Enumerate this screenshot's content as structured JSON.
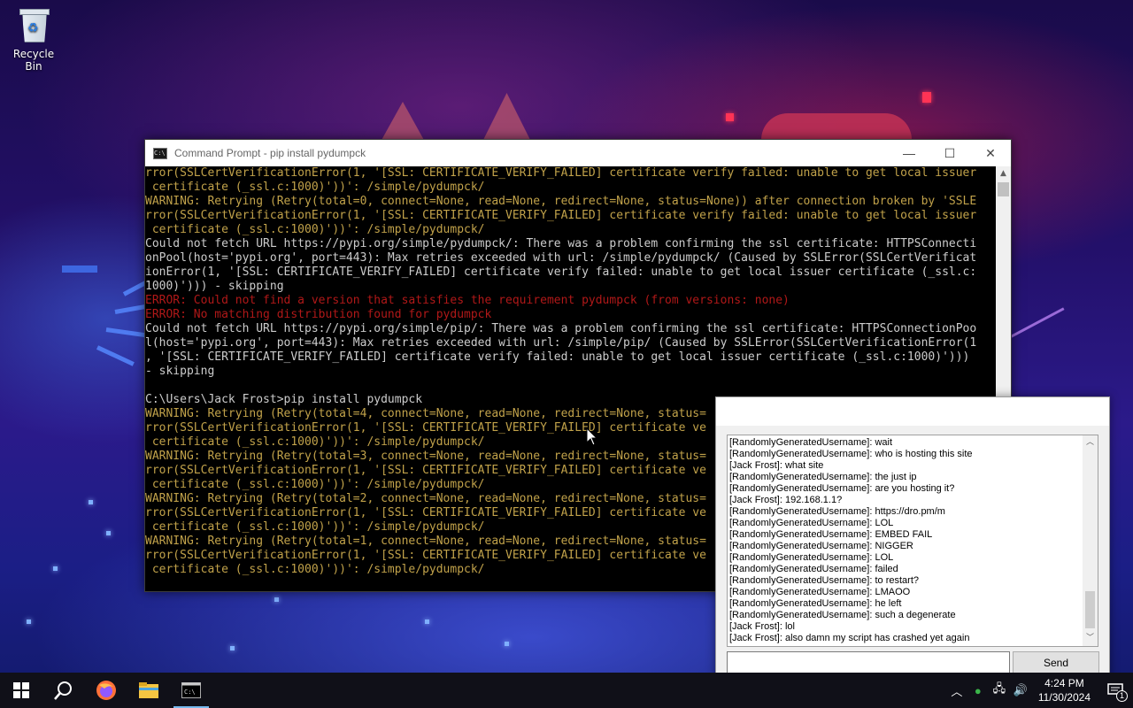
{
  "desktop": {
    "recycle_bin_label": "Recycle Bin"
  },
  "cmd_window": {
    "title": "Command Prompt - pip  install pydumpck",
    "minimize": "—",
    "maximize": "☐",
    "close": "✕",
    "lines": [
      {
        "text": "rror(SSLCertVerificationError(1, '[SSL: CERTIFICATE_VERIFY_FAILED] certificate verify failed: unable to get local issuer",
        "color": "yellow"
      },
      {
        "text": " certificate (_ssl.c:1000)'))': /simple/pydumpck/",
        "color": "yellow"
      },
      {
        "text": "WARNING: Retrying (Retry(total=0, connect=None, read=None, redirect=None, status=None)) after connection broken by 'SSLE",
        "color": "yellow"
      },
      {
        "text": "rror(SSLCertVerificationError(1, '[SSL: CERTIFICATE_VERIFY_FAILED] certificate verify failed: unable to get local issuer",
        "color": "yellow"
      },
      {
        "text": " certificate (_ssl.c:1000)'))': /simple/pydumpck/",
        "color": "yellow"
      },
      {
        "text": "Could not fetch URL https://pypi.org/simple/pydumpck/: There was a problem confirming the ssl certificate: HTTPSConnecti",
        "color": "white"
      },
      {
        "text": "onPool(host='pypi.org', port=443): Max retries exceeded with url: /simple/pydumpck/ (Caused by SSLError(SSLCertVerificat",
        "color": "white"
      },
      {
        "text": "ionError(1, '[SSL: CERTIFICATE_VERIFY_FAILED] certificate verify failed: unable to get local issuer certificate (_ssl.c:",
        "color": "white"
      },
      {
        "text": "1000)'))) - skipping",
        "color": "white"
      },
      {
        "text": "ERROR: Could not find a version that satisfies the requirement pydumpck (from versions: none)",
        "color": "red"
      },
      {
        "text": "ERROR: No matching distribution found for pydumpck",
        "color": "red"
      },
      {
        "text": "Could not fetch URL https://pypi.org/simple/pip/: There was a problem confirming the ssl certificate: HTTPSConnectionPoo",
        "color": "white"
      },
      {
        "text": "l(host='pypi.org', port=443): Max retries exceeded with url: /simple/pip/ (Caused by SSLError(SSLCertVerificationError(1",
        "color": "white"
      },
      {
        "text": ", '[SSL: CERTIFICATE_VERIFY_FAILED] certificate verify failed: unable to get local issuer certificate (_ssl.c:1000)')))",
        "color": "white"
      },
      {
        "text": "- skipping",
        "color": "white"
      },
      {
        "text": "",
        "color": "white"
      },
      {
        "text": "C:\\Users\\Jack Frost>pip install pydumpck",
        "color": "white"
      },
      {
        "text": "WARNING: Retrying (Retry(total=4, connect=None, read=None, redirect=None, status=",
        "color": "yellow"
      },
      {
        "text": "rror(SSLCertVerificationError(1, '[SSL: CERTIFICATE_VERIFY_FAILED] certificate ve",
        "color": "yellow"
      },
      {
        "text": " certificate (_ssl.c:1000)'))': /simple/pydumpck/",
        "color": "yellow"
      },
      {
        "text": "WARNING: Retrying (Retry(total=3, connect=None, read=None, redirect=None, status=",
        "color": "yellow"
      },
      {
        "text": "rror(SSLCertVerificationError(1, '[SSL: CERTIFICATE_VERIFY_FAILED] certificate ve",
        "color": "yellow"
      },
      {
        "text": " certificate (_ssl.c:1000)'))': /simple/pydumpck/",
        "color": "yellow"
      },
      {
        "text": "WARNING: Retrying (Retry(total=2, connect=None, read=None, redirect=None, status=",
        "color": "yellow"
      },
      {
        "text": "rror(SSLCertVerificationError(1, '[SSL: CERTIFICATE_VERIFY_FAILED] certificate ve",
        "color": "yellow"
      },
      {
        "text": " certificate (_ssl.c:1000)'))': /simple/pydumpck/",
        "color": "yellow"
      },
      {
        "text": "WARNING: Retrying (Retry(total=1, connect=None, read=None, redirect=None, status=",
        "color": "yellow"
      },
      {
        "text": "rror(SSLCertVerificationError(1, '[SSL: CERTIFICATE_VERIFY_FAILED] certificate ve",
        "color": "yellow"
      },
      {
        "text": " certificate (_ssl.c:1000)'))': /simple/pydumpck/",
        "color": "yellow"
      }
    ]
  },
  "chat_window": {
    "messages": [
      "[RandomlyGeneratedUsername]: wait",
      "[RandomlyGeneratedUsername]: who is hosting this site",
      "[Jack Frost]: what site",
      "[RandomlyGeneratedUsername]: the just ip",
      "[RandomlyGeneratedUsername]: are you hosting it?",
      "[Jack Frost]: 192.168.1.1?",
      "[RandomlyGeneratedUsername]: https://dro.pm/m",
      "[RandomlyGeneratedUsername]: LOL",
      "[RandomlyGeneratedUsername]: EMBED FAIL",
      "[RandomlyGeneratedUsername]: NIGGER",
      "[RandomlyGeneratedUsername]: LOL",
      "[RandomlyGeneratedUsername]: failed",
      "[RandomlyGeneratedUsername]: to restart?",
      "[RandomlyGeneratedUsername]: LMAOO",
      "[RandomlyGeneratedUsername]: he left",
      "[RandomlyGeneratedUsername]: such a degenerate",
      "[Jack Frost]: lol",
      "[Jack Frost]: also damn my script has crashed yet again"
    ],
    "input_value": "",
    "send_label": "Send"
  },
  "taskbar": {
    "items": [
      "windows-start-icon",
      "search-icon",
      "firefox-icon",
      "file-explorer-icon",
      "command-prompt-icon"
    ],
    "clock_time": "4:24 PM",
    "clock_date": "11/30/2024",
    "notification_count": "1"
  },
  "colors": {
    "terminal_white": "#cccccc",
    "terminal_yellow": "#c1a24a",
    "terminal_red": "#b01818",
    "taskbar_bg": "#101018"
  }
}
